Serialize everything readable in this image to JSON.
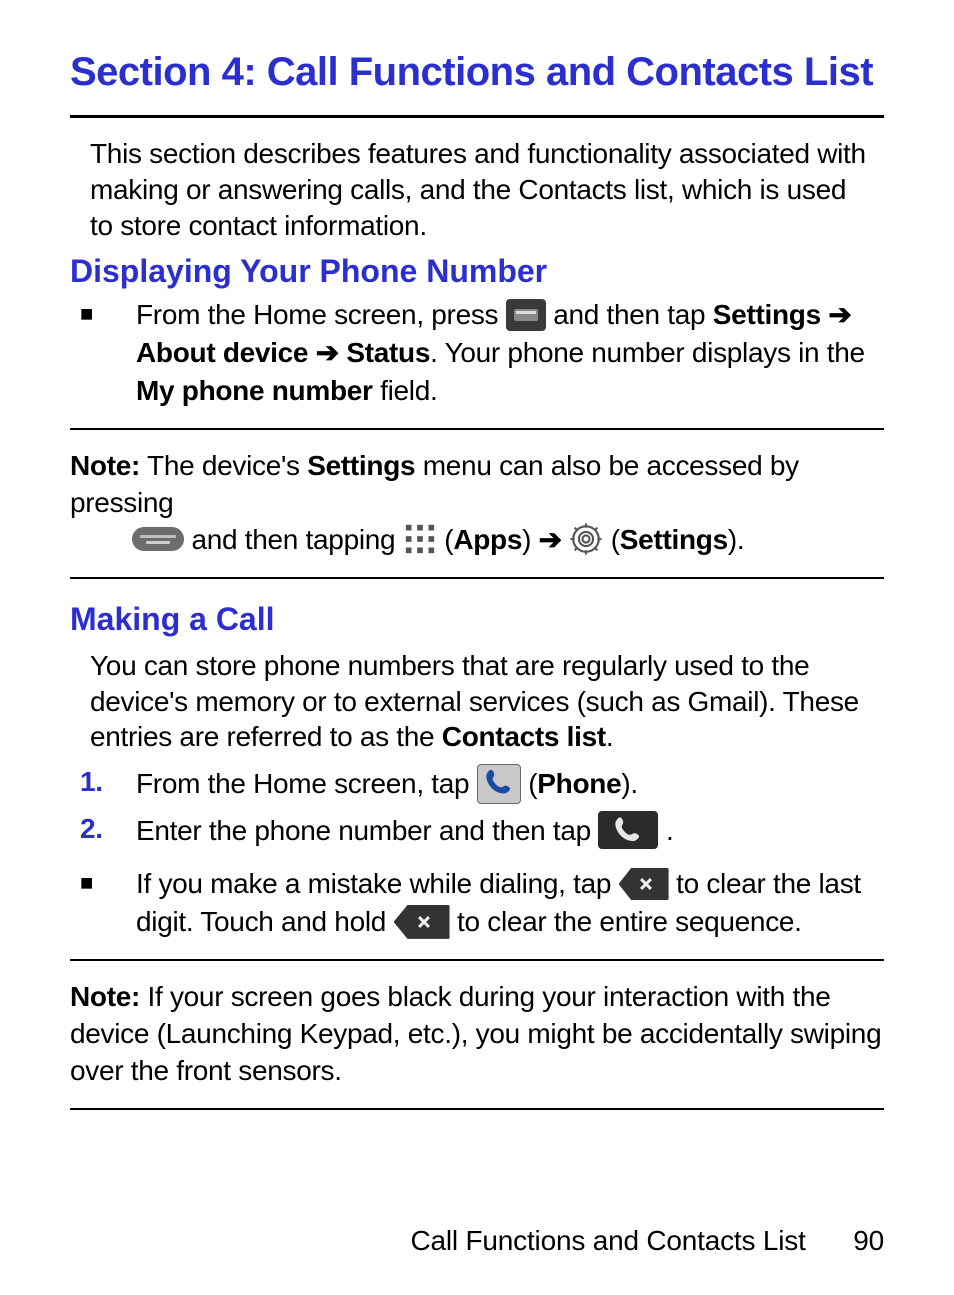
{
  "title": "Section 4: Call Functions and Contacts List",
  "intro": "This section describes features and functionality associated with making or answering calls, and the Contacts list, which is used to store contact information.",
  "sub1": {
    "head": "Displaying Your Phone Number",
    "bullet": {
      "p1": "From the Home screen, press ",
      "p2": " and then tap ",
      "settings": "Settings",
      "arrow": " ➔ ",
      "about": "About device",
      "status": "Status",
      "p3": ". Your phone number displays in the ",
      "myphone": "My phone number",
      "p4": " field."
    }
  },
  "note1": {
    "label": "Note:",
    "p1": " The device's ",
    "settings": "Settings",
    "p2": " menu can also be accessed by pressing ",
    "p3": " and then tapping ",
    "apps": "Apps",
    "arrow": " ➔ ",
    "settings2": "Settings",
    "close": ")."
  },
  "sub2": {
    "head": "Making a Call",
    "intro_a": "You can store phone numbers that are regularly used to the device's memory or to external services (such as Gmail). These entries are referred to as the ",
    "contacts": "Contacts list",
    "intro_b": ".",
    "s1a": "From the Home screen, tap ",
    "s1b_open": " (",
    "phone": "Phone",
    "s1b_close": ").",
    "s2a": "Enter the phone number and then tap ",
    "s2b": ".",
    "b_a": "If you make a mistake while dialing, tap ",
    "b_b": " to clear the last digit. Touch and hold ",
    "b_c": " to clear the entire sequence."
  },
  "note2": {
    "label": "Note:",
    "text": " If your screen goes black during your interaction with the device (Launching Keypad, etc.), you might be accidentally swiping over the front sensors."
  },
  "footer": {
    "title": "Call Functions and Contacts List",
    "page": "90"
  },
  "markers": {
    "n1": "1.",
    "n2": "2."
  }
}
